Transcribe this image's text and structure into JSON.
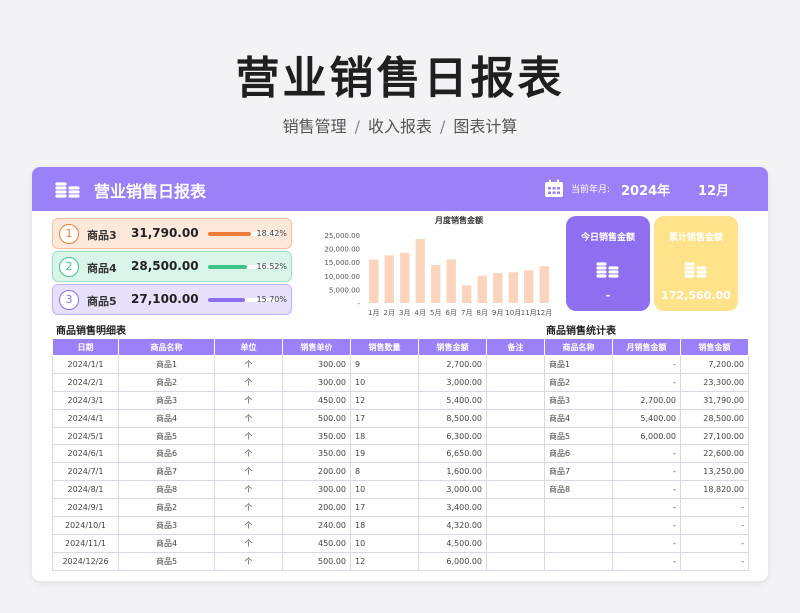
{
  "page": {
    "title": "营业销售日报表",
    "subtitle": [
      "销售管理",
      "收入报表",
      "图表计算"
    ],
    "separator": "/"
  },
  "header": {
    "title": "营业销售日报表",
    "date_label": "当前年月:",
    "year": "2024年",
    "month": "12月",
    "icons": [
      "coins-stack-icon",
      "calendar-icon"
    ]
  },
  "colors": {
    "accent": "#9b81f7",
    "orange": "#f07c3a",
    "green": "#3cc48a",
    "purple": "#8d6ff0",
    "yellow": "#ffe28a",
    "bar": "#fbd4bd"
  },
  "top_products": [
    {
      "rank": "1",
      "name": "商品3",
      "value": "31,790.00",
      "pct": "18.42%",
      "share": 0.1842,
      "color": "#f07c3a",
      "bg": "#fde8dc"
    },
    {
      "rank": "2",
      "name": "商品4",
      "value": "28,500.00",
      "pct": "16.52%",
      "share": 0.1652,
      "color": "#3cc48a",
      "bg": "#d8f5e8"
    },
    {
      "rank": "3",
      "name": "商品5",
      "value": "27,100.00",
      "pct": "15.70%",
      "share": 0.157,
      "color": "#8d6ff0",
      "bg": "#e6e0fb"
    }
  ],
  "chart_data": {
    "type": "bar",
    "title": "月度销售金额",
    "categories": [
      "1月",
      "2月",
      "3月",
      "4月",
      "5月",
      "6月",
      "7月",
      "8月",
      "9月",
      "10月",
      "11月",
      "12月"
    ],
    "values": [
      16000,
      17500,
      18500,
      23500,
      14000,
      16000,
      6500,
      10000,
      11000,
      11300,
      12000,
      13500
    ],
    "ylim": [
      0,
      25000
    ],
    "yticks": [
      "25,000.00",
      "20,000.00",
      "15,000.00",
      "10,000.00",
      "5,000.00",
      "-"
    ],
    "grid": false
  },
  "kpis": {
    "today": {
      "label": "今日销售金额",
      "value": "-"
    },
    "total": {
      "label": "累计销售金额",
      "value": "172,560.00"
    }
  },
  "detail": {
    "title": "商品销售明细表",
    "headers": [
      "日期",
      "商品名称",
      "单位",
      "销售单价",
      "销售数量",
      "销售金额",
      "备注"
    ],
    "rows": [
      [
        "2024/1/1",
        "商品1",
        "个",
        "300.00",
        "9",
        "2,700.00",
        ""
      ],
      [
        "2024/2/1",
        "商品2",
        "个",
        "300.00",
        "10",
        "3,000.00",
        ""
      ],
      [
        "2024/3/1",
        "商品3",
        "个",
        "450.00",
        "12",
        "5,400.00",
        ""
      ],
      [
        "2024/4/1",
        "商品4",
        "个",
        "500.00",
        "17",
        "8,500.00",
        ""
      ],
      [
        "2024/5/1",
        "商品5",
        "个",
        "350.00",
        "18",
        "6,300.00",
        ""
      ],
      [
        "2024/6/1",
        "商品6",
        "个",
        "350.00",
        "19",
        "6,650.00",
        ""
      ],
      [
        "2024/7/1",
        "商品7",
        "个",
        "200.00",
        "8",
        "1,600.00",
        ""
      ],
      [
        "2024/8/1",
        "商品8",
        "个",
        "300.00",
        "10",
        "3,000.00",
        ""
      ],
      [
        "2024/9/1",
        "商品2",
        "个",
        "200.00",
        "17",
        "3,400.00",
        ""
      ],
      [
        "2024/10/1",
        "商品3",
        "个",
        "240.00",
        "18",
        "4,320.00",
        ""
      ],
      [
        "2024/11/1",
        "商品4",
        "个",
        "450.00",
        "10",
        "4,500.00",
        ""
      ],
      [
        "2024/12/26",
        "商品5",
        "个",
        "500.00",
        "12",
        "6,000.00",
        ""
      ]
    ]
  },
  "stats": {
    "title": "商品销售统计表",
    "headers": [
      "商品名称",
      "月销售金额",
      "销售金额"
    ],
    "rows": [
      [
        "商品1",
        "-",
        "7,200.00"
      ],
      [
        "商品2",
        "-",
        "23,300.00"
      ],
      [
        "商品3",
        "2,700.00",
        "31,790.00"
      ],
      [
        "商品4",
        "5,400.00",
        "28,500.00"
      ],
      [
        "商品5",
        "6,000.00",
        "27,100.00"
      ],
      [
        "商品6",
        "-",
        "22,600.00"
      ],
      [
        "商品7",
        "-",
        "13,250.00"
      ],
      [
        "商品8",
        "-",
        "18,820.00"
      ],
      [
        "",
        "-",
        "-"
      ],
      [
        "",
        "-",
        "-"
      ],
      [
        "",
        "-",
        "-"
      ],
      [
        "",
        "-",
        "-"
      ]
    ]
  }
}
